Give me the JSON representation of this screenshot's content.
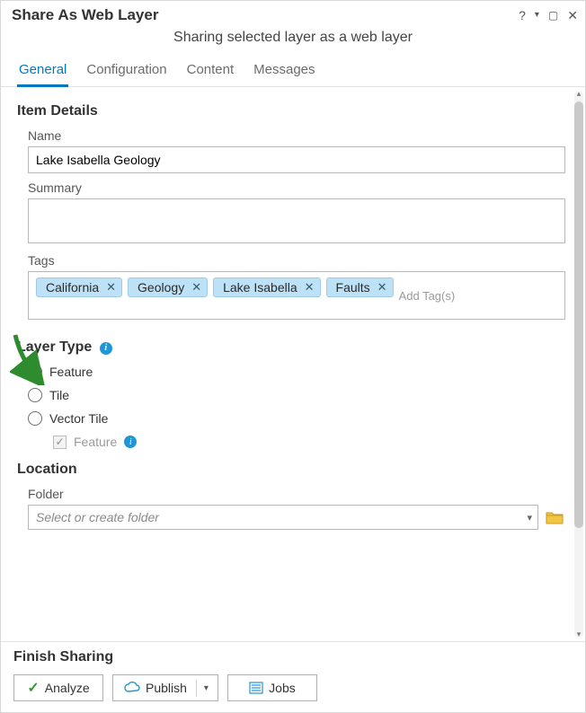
{
  "window": {
    "title": "Share As Web Layer",
    "subtitle": "Sharing selected layer as a web layer"
  },
  "tabs": [
    {
      "label": "General",
      "active": true
    },
    {
      "label": "Configuration",
      "active": false
    },
    {
      "label": "Content",
      "active": false
    },
    {
      "label": "Messages",
      "active": false
    }
  ],
  "item_details": {
    "section_title": "Item Details",
    "name_label": "Name",
    "name_value": "Lake Isabella Geology",
    "summary_label": "Summary",
    "summary_value": "",
    "tags_label": "Tags",
    "tags": [
      "California",
      "Geology",
      "Lake Isabella",
      "Faults"
    ],
    "add_tags_placeholder": "Add Tag(s)"
  },
  "layer_type": {
    "section_title": "Layer Type",
    "options": [
      {
        "label": "Feature",
        "selected": true
      },
      {
        "label": "Tile",
        "selected": false
      },
      {
        "label": "Vector Tile",
        "selected": false
      }
    ],
    "sub_feature_label": "Feature",
    "sub_feature_checked": true,
    "sub_feature_disabled": true
  },
  "location": {
    "section_title": "Location",
    "folder_label": "Folder",
    "folder_placeholder": "Select or create folder"
  },
  "footer": {
    "section_title": "Finish Sharing",
    "analyze_label": "Analyze",
    "publish_label": "Publish",
    "jobs_label": "Jobs"
  }
}
